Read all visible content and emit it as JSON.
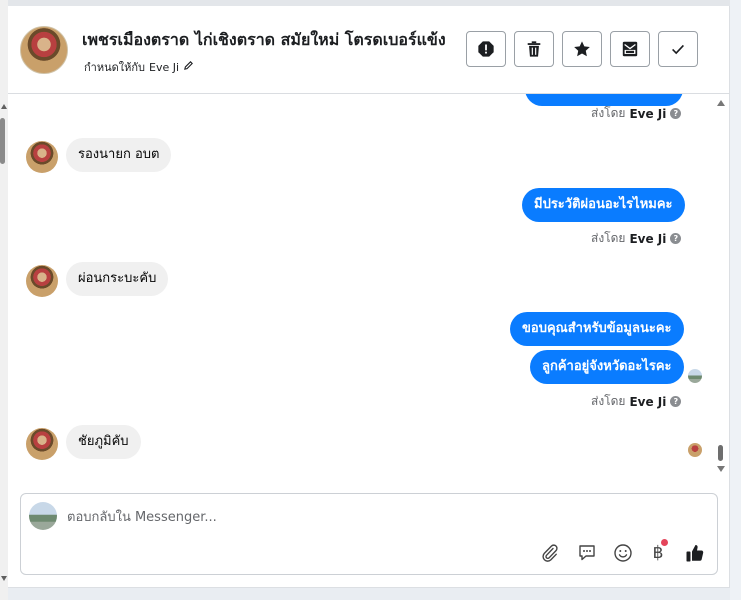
{
  "header": {
    "title": "เพชรเมืองตราด ไก่เชิงตราด สมัยใหม่ โตรดเบอร์แข้ง",
    "assigned_prefix": "กำหนดให้กับ",
    "assigned_name": "Eve Ji",
    "actions": [
      {
        "name": "spam",
        "icon": "alert-octagon-icon"
      },
      {
        "name": "delete",
        "icon": "trash-icon"
      },
      {
        "name": "star",
        "icon": "star-icon"
      },
      {
        "name": "mark-unread",
        "icon": "envelope-icon"
      },
      {
        "name": "done",
        "icon": "checkmark-icon"
      }
    ]
  },
  "messages": {
    "sent_by_prefix": "ส่งโดย",
    "sender": "Eve Ji",
    "items": [
      {
        "direction": "out",
        "text": ""
      },
      {
        "direction": "in",
        "text": "รองนายก อบต"
      },
      {
        "direction": "out",
        "text": "มีประวัติผ่อนอะไรไหมคะ"
      },
      {
        "direction": "in",
        "text": "ผ่อนกระบะคับ"
      },
      {
        "direction": "out",
        "text": "ขอบคุณสำหรับข้อมูลนะคะ"
      },
      {
        "direction": "out",
        "text": "ลูกค้าอยู่จังหวัดอะไรคะ"
      },
      {
        "direction": "in",
        "text": "ชัยภูมิคับ"
      }
    ]
  },
  "reply": {
    "placeholder": "ตอบกลับใน Messenger...",
    "value": "",
    "tools": [
      "paperclip-icon",
      "saved-replies-icon",
      "emoji-icon",
      "baht-icon",
      "thumbs-up-icon"
    ],
    "baht_symbol": "฿"
  },
  "colors": {
    "outgoing_bubble": "#0a7cff",
    "incoming_bubble": "#f0f0f0",
    "notification_dot": "#e4455b"
  }
}
